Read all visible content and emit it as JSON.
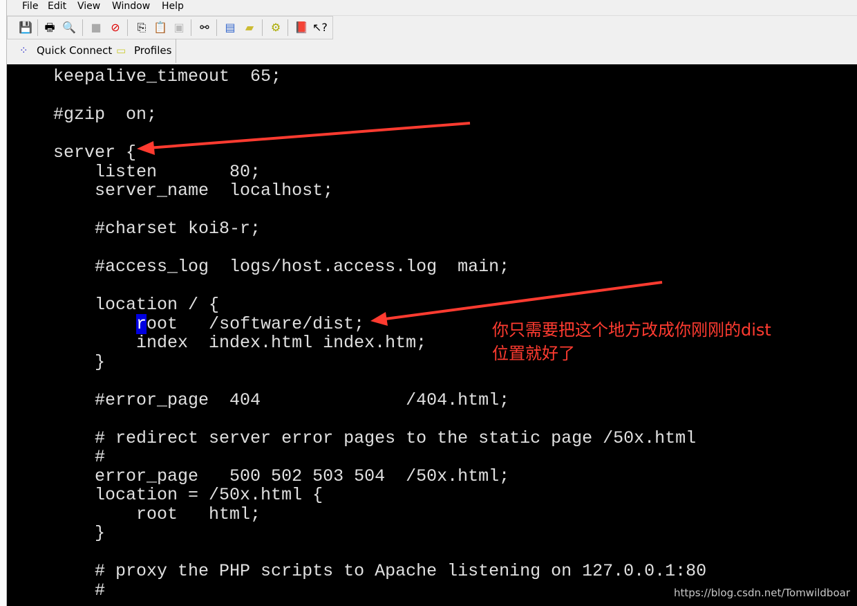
{
  "menu": [
    "File",
    "Edit",
    "View",
    "Window",
    "Help"
  ],
  "toolbar_icons": [
    "save-icon",
    "print-icon",
    "print-preview-icon",
    "connect-icon",
    "disconnect-icon",
    "copy-icon",
    "paste-icon",
    "paste-disabled-icon",
    "find-icon",
    "new-window-icon",
    "folder-transfer-icon",
    "settings-icon",
    "help-book-icon",
    "context-help-icon"
  ],
  "quickbar": {
    "quick_connect": "Quick Connect",
    "profiles": "Profiles"
  },
  "terminal": {
    "lines": [
      "    keepalive_timeout  65;",
      "",
      "    #gzip  on;",
      "",
      "    server {",
      "        listen       80;",
      "        server_name  localhost;",
      "",
      "        #charset koi8-r;",
      "",
      "        #access_log  logs/host.access.log  main;",
      "",
      "        location / {",
      "ROOT",
      "            index  index.html index.htm;",
      "        }",
      "",
      "        #error_page  404              /404.html;",
      "",
      "        # redirect server error pages to the static page /50x.html",
      "        #",
      "        error_page   500 502 503 504  /50x.html;",
      "        location = /50x.html {",
      "            root   html;",
      "        }",
      "",
      "        # proxy the PHP scripts to Apache listening on 127.0.0.1:80",
      "        #"
    ],
    "root_line": {
      "indent": "            ",
      "cursor_char": "r",
      "rest": "oot   /software/dist;"
    }
  },
  "annotation": {
    "line1": "你只需要把这个地方改成你刚刚的dist",
    "line2": "位置就好了",
    "color": "#ff3b30"
  },
  "watermark": "https://blog.csdn.net/Tomwildboar"
}
